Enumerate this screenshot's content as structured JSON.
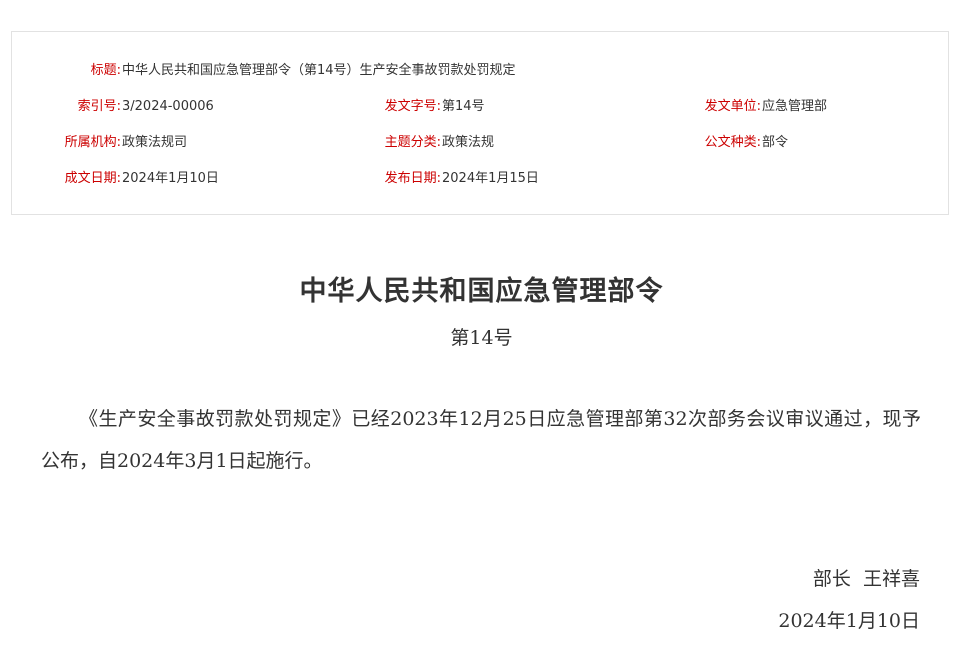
{
  "meta": {
    "title": {
      "label": "标题:",
      "value": "中华人民共和国应急管理部令（第14号）生产安全事故罚款处罚规定"
    },
    "index_no": {
      "label": "索引号:",
      "value": "3/2024-00006"
    },
    "doc_no": {
      "label": "发文字号:",
      "value": "第14号"
    },
    "issuer": {
      "label": "发文单位:",
      "value": "应急管理部"
    },
    "agency": {
      "label": "所属机构:",
      "value": "政策法规司"
    },
    "category": {
      "label": "主题分类:",
      "value": "政策法规"
    },
    "doc_type": {
      "label": "公文种类:",
      "value": "部令"
    },
    "written_date": {
      "label": "成文日期:",
      "value": "2024年1月10日"
    },
    "publish_date": {
      "label": "发布日期:",
      "value": "2024年1月15日"
    }
  },
  "document": {
    "title": "中华人民共和国应急管理部令",
    "number": "第14号",
    "body": "《生产安全事故罚款处罚规定》已经2023年12月25日应急管理部第32次部务会议审议通过，现予公布，自2024年3月1日起施行。",
    "signer": "部长  王祥喜",
    "date": "2024年1月10日"
  }
}
